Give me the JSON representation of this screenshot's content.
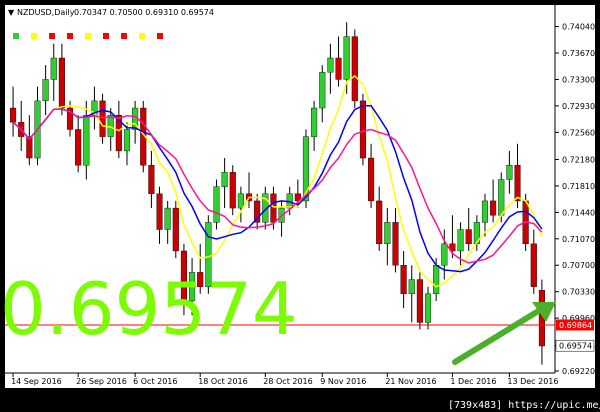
{
  "header": {
    "symbol": "NZDUSD,Daily",
    "ohlc": "0.70347 0.70500 0.69310 0.69574"
  },
  "big_price": "0.69574",
  "price_tags": {
    "line_price": "0.69864",
    "bid": "0.69574"
  },
  "watermark": "[739x483] https://upic.me/",
  "colors": {
    "bull": "#32cd32",
    "bear": "#cc0000",
    "ma_fast": "#ffff00",
    "ma_mid": "#0000ff",
    "ma_slow": "#ff1493",
    "level_line": "#ff0000",
    "big_text": "#7CFC00",
    "arrow": "#4caf2a"
  },
  "signal_dots": [
    "green",
    "yellow",
    "red",
    "red",
    "yellow",
    "red",
    "red",
    "yellow",
    "red"
  ],
  "chart_data": {
    "type": "candlestick",
    "title": "NZDUSD,Daily",
    "y_ticks": [
      "0.74040",
      "0.73670",
      "0.73300",
      "0.72930",
      "0.72560",
      "0.72180",
      "0.71810",
      "0.71440",
      "0.71070",
      "0.70700",
      "0.70330",
      "0.69960",
      "0.69574",
      "0.69220"
    ],
    "ylim": [
      0.6922,
      0.7416
    ],
    "x_ticks": [
      "14 Sep 2016",
      "26 Sep 2016",
      "6 Oct 2016",
      "18 Oct 2016",
      "28 Oct 2016",
      "9 Nov 2016",
      "21 Nov 2016",
      "1 Dec 2016",
      "13 Dec 2016"
    ],
    "level": 0.69864,
    "candles": [
      [
        0.729,
        0.732,
        0.725,
        0.727
      ],
      [
        0.727,
        0.73,
        0.723,
        0.725
      ],
      [
        0.725,
        0.728,
        0.721,
        0.722
      ],
      [
        0.722,
        0.732,
        0.721,
        0.73
      ],
      [
        0.73,
        0.735,
        0.728,
        0.733
      ],
      [
        0.733,
        0.738,
        0.73,
        0.736
      ],
      [
        0.736,
        0.738,
        0.728,
        0.729
      ],
      [
        0.729,
        0.73,
        0.725,
        0.726
      ],
      [
        0.726,
        0.728,
        0.72,
        0.721
      ],
      [
        0.721,
        0.73,
        0.719,
        0.728
      ],
      [
        0.728,
        0.732,
        0.726,
        0.73
      ],
      [
        0.73,
        0.731,
        0.724,
        0.725
      ],
      [
        0.725,
        0.729,
        0.723,
        0.728
      ],
      [
        0.728,
        0.73,
        0.722,
        0.723
      ],
      [
        0.723,
        0.727,
        0.721,
        0.726
      ],
      [
        0.726,
        0.73,
        0.724,
        0.729
      ],
      [
        0.729,
        0.73,
        0.72,
        0.721
      ],
      [
        0.721,
        0.723,
        0.715,
        0.717
      ],
      [
        0.717,
        0.718,
        0.71,
        0.712
      ],
      [
        0.712,
        0.716,
        0.71,
        0.715
      ],
      [
        0.715,
        0.716,
        0.708,
        0.709
      ],
      [
        0.709,
        0.71,
        0.7,
        0.702
      ],
      [
        0.702,
        0.708,
        0.7,
        0.706
      ],
      [
        0.706,
        0.71,
        0.703,
        0.704
      ],
      [
        0.704,
        0.714,
        0.703,
        0.713
      ],
      [
        0.713,
        0.719,
        0.712,
        0.718
      ],
      [
        0.718,
        0.722,
        0.715,
        0.72
      ],
      [
        0.72,
        0.721,
        0.714,
        0.715
      ],
      [
        0.715,
        0.718,
        0.713,
        0.717
      ],
      [
        0.717,
        0.72,
        0.715,
        0.716
      ],
      [
        0.716,
        0.717,
        0.712,
        0.713
      ],
      [
        0.713,
        0.718,
        0.712,
        0.717
      ],
      [
        0.717,
        0.718,
        0.712,
        0.713
      ],
      [
        0.713,
        0.716,
        0.711,
        0.715
      ],
      [
        0.715,
        0.718,
        0.714,
        0.717
      ],
      [
        0.717,
        0.719,
        0.715,
        0.716
      ],
      [
        0.716,
        0.726,
        0.715,
        0.725
      ],
      [
        0.725,
        0.73,
        0.723,
        0.729
      ],
      [
        0.729,
        0.735,
        0.727,
        0.734
      ],
      [
        0.734,
        0.738,
        0.731,
        0.736
      ],
      [
        0.736,
        0.739,
        0.732,
        0.733
      ],
      [
        0.733,
        0.741,
        0.731,
        0.739
      ],
      [
        0.739,
        0.74,
        0.729,
        0.73
      ],
      [
        0.73,
        0.731,
        0.721,
        0.722
      ],
      [
        0.722,
        0.724,
        0.715,
        0.716
      ],
      [
        0.716,
        0.718,
        0.709,
        0.71
      ],
      [
        0.71,
        0.715,
        0.707,
        0.713
      ],
      [
        0.713,
        0.715,
        0.706,
        0.707
      ],
      [
        0.707,
        0.709,
        0.701,
        0.703
      ],
      [
        0.703,
        0.707,
        0.699,
        0.705
      ],
      [
        0.705,
        0.706,
        0.698,
        0.699
      ],
      [
        0.699,
        0.704,
        0.698,
        0.703
      ],
      [
        0.703,
        0.708,
        0.702,
        0.707
      ],
      [
        0.707,
        0.712,
        0.705,
        0.71
      ],
      [
        0.71,
        0.714,
        0.708,
        0.709
      ],
      [
        0.709,
        0.713,
        0.707,
        0.712
      ],
      [
        0.712,
        0.715,
        0.709,
        0.71
      ],
      [
        0.71,
        0.714,
        0.709,
        0.713
      ],
      [
        0.713,
        0.717,
        0.711,
        0.716
      ],
      [
        0.716,
        0.719,
        0.713,
        0.714
      ],
      [
        0.714,
        0.72,
        0.713,
        0.719
      ],
      [
        0.719,
        0.723,
        0.717,
        0.721
      ],
      [
        0.721,
        0.724,
        0.715,
        0.716
      ],
      [
        0.716,
        0.717,
        0.709,
        0.71
      ],
      [
        0.71,
        0.712,
        0.703,
        0.704
      ],
      [
        0.7035,
        0.705,
        0.6931,
        0.6957
      ]
    ]
  }
}
